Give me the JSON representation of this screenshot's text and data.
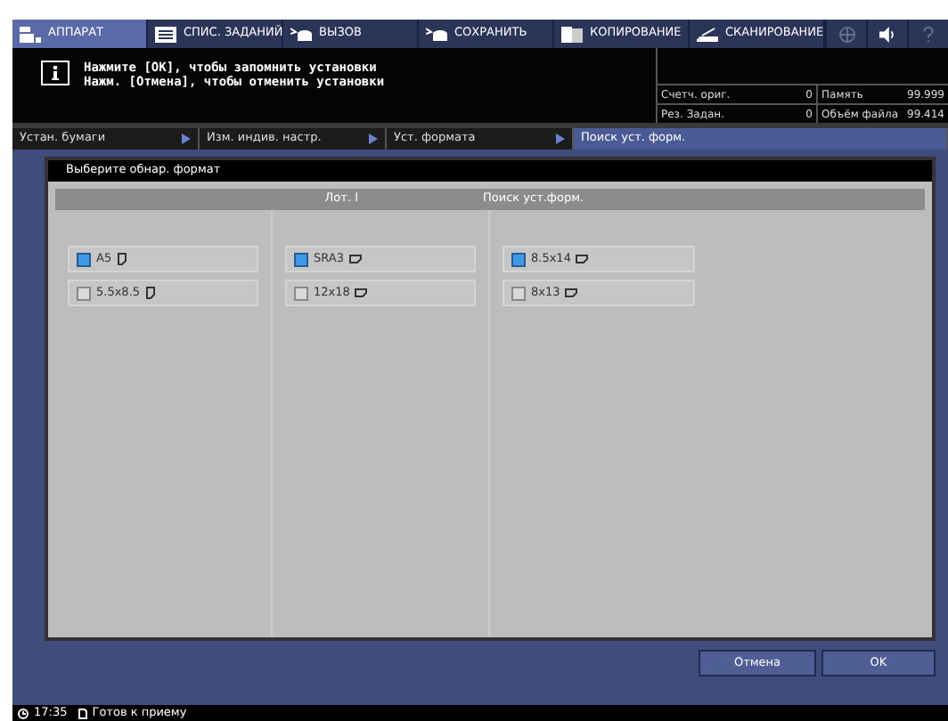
{
  "top_tabs": [
    {
      "label": "АППАРАТ",
      "kind": "machine",
      "selected": true
    },
    {
      "label": "СПИС. ЗАДАНИЙ",
      "kind": "list",
      "selected": false
    },
    {
      "label": "ВЫЗОВ",
      "kind": "recall",
      "selected": false
    },
    {
      "label": "СОХРАНИТЬ",
      "kind": "save",
      "selected": false
    },
    {
      "label": "КОПИРОВАНИЕ",
      "kind": "copy",
      "selected": false
    },
    {
      "label": "СКАНИРОВАНИЕ",
      "kind": "scan",
      "selected": false
    }
  ],
  "top_icons": [
    {
      "kind": "globe",
      "disabled": true
    },
    {
      "kind": "speaker",
      "disabled": false
    },
    {
      "kind": "help",
      "disabled": true
    }
  ],
  "message": [
    "Нажмите [OK], чтобы запомнить установки",
    "Нажм. [Отмена], чтобы отменить установки"
  ],
  "counters": [
    {
      "label": "Счетч. ориг.",
      "value": "0",
      "label2": "Память",
      "value2": "99.999"
    },
    {
      "label": "Рез. Задан.",
      "value": "0",
      "label2": "Объём файла",
      "value2": "99.414"
    }
  ],
  "breadcrumb": [
    {
      "label": "Устан. бумаги",
      "selected": false
    },
    {
      "label": "Изм. индив. настр.",
      "selected": false
    },
    {
      "label": "Уст. формата",
      "selected": false
    },
    {
      "label": "Поиск уст. форм.",
      "selected": true
    }
  ],
  "panel": {
    "title": "Выберите обнар. формат",
    "header": [
      "Лот. I",
      "Поиск уст.форм."
    ],
    "columns": [
      [
        {
          "label": "A5",
          "kind": "portrait",
          "checked": true
        },
        {
          "label": "5.5x8.5",
          "kind": "portrait",
          "checked": false
        }
      ],
      [
        {
          "label": "SRA3",
          "kind": "landscape",
          "checked": true
        },
        {
          "label": "12x18",
          "kind": "landscape",
          "checked": false
        }
      ],
      [
        {
          "label": "8.5x14",
          "kind": "landscape",
          "checked": true
        },
        {
          "label": "8x13",
          "kind": "landscape",
          "checked": false
        }
      ]
    ]
  },
  "buttons": [
    "Отмена",
    "OK"
  ],
  "status_bar": {
    "time": "17:35",
    "text": "Готов к приему"
  }
}
